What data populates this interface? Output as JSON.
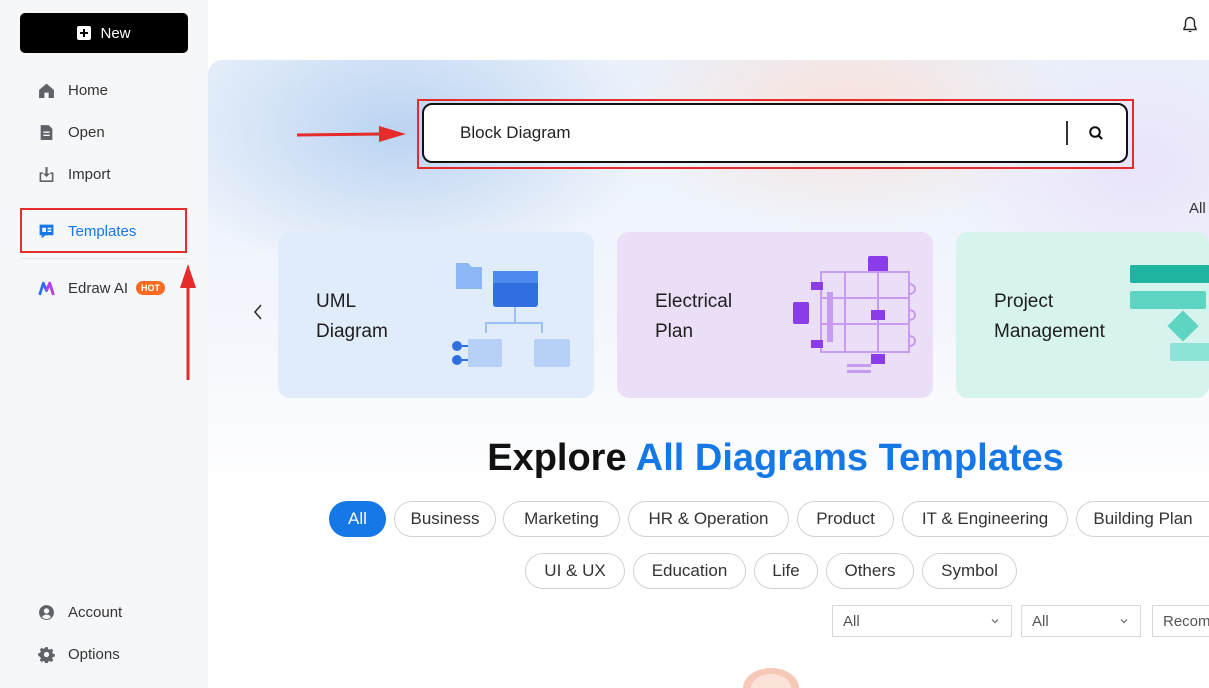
{
  "sidebar": {
    "new_label": "New",
    "items": [
      {
        "label": "Home",
        "icon": "home-icon"
      },
      {
        "label": "Open",
        "icon": "file-icon"
      },
      {
        "label": "Import",
        "icon": "import-icon"
      },
      {
        "label": "Templates",
        "icon": "templates-icon"
      },
      {
        "label": "Edraw AI",
        "icon": "edraw-ai-icon",
        "badge": "HOT"
      }
    ],
    "bottom": [
      {
        "label": "Account",
        "icon": "account-icon"
      },
      {
        "label": "Options",
        "icon": "gear-icon"
      }
    ]
  },
  "search": {
    "value": "Block Diagram",
    "icon": "search-icon"
  },
  "all_link": "All",
  "cards": [
    {
      "title": "UML\nDiagram",
      "color": "#e1ecfb"
    },
    {
      "title": "Electrical\nPlan",
      "color": "#ebdff8"
    },
    {
      "title": "Project\nManagement",
      "color": "#d6f3ee"
    }
  ],
  "explore": {
    "prefix": "Explore",
    "highlight": "All Diagrams Templates"
  },
  "categories_row1": [
    "All",
    "Business",
    "Marketing",
    "HR & Operation",
    "Product",
    "IT & Engineering",
    "Building Plan"
  ],
  "categories_row2": [
    "UI & UX",
    "Education",
    "Life",
    "Others",
    "Symbol"
  ],
  "filters": [
    "All",
    "All",
    "Recomm"
  ],
  "colors": {
    "accent": "#1677e6",
    "annotation": "#e52b2b"
  }
}
